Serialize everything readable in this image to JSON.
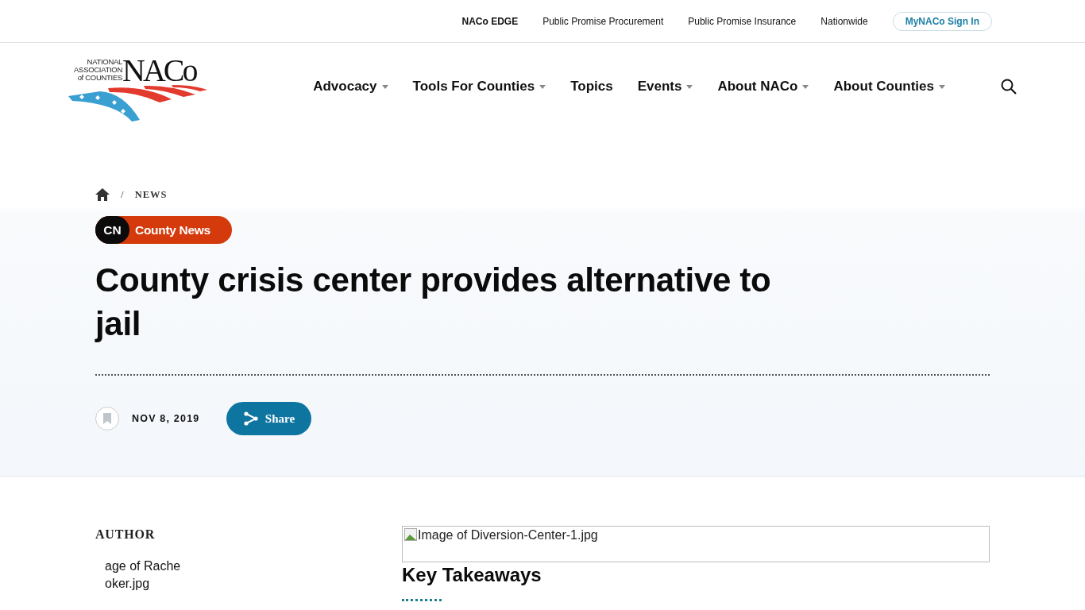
{
  "top_links": [
    {
      "label": "NACo EDGE",
      "kind": "bold"
    },
    {
      "label": "Public Promise Procurement",
      "kind": "plain"
    },
    {
      "label": "Public Promise Insurance",
      "kind": "plain"
    },
    {
      "label": "Nationwide",
      "kind": "plain"
    },
    {
      "label": "MyNACo Sign In",
      "kind": "pill"
    }
  ],
  "logo": {
    "small_lines": [
      "NATIONAL",
      "ASSOCIATION",
      "of COUNTIES"
    ],
    "wordmark": "NACo"
  },
  "nav": [
    {
      "label": "Advocacy",
      "dropdown": true
    },
    {
      "label": "Tools For Counties",
      "dropdown": true
    },
    {
      "label": "Topics",
      "dropdown": false
    },
    {
      "label": "Events",
      "dropdown": true
    },
    {
      "label": "About NACo",
      "dropdown": true
    },
    {
      "label": "About Counties",
      "dropdown": true
    }
  ],
  "breadcrumb": {
    "separator": "/",
    "current": "NEWS"
  },
  "category": {
    "code": "CN",
    "label": "County News"
  },
  "title": "County crisis center provides alternative to jail",
  "date": "NOV 8, 2019",
  "share": "Share",
  "author": {
    "heading": "AUTHOR",
    "image_alt_lines": [
      "age of Rache",
      "oker.jpg"
    ]
  },
  "main_image_alt": "Image of Diversion-Center-1.jpg",
  "section_heading": "Key Takeaways"
}
